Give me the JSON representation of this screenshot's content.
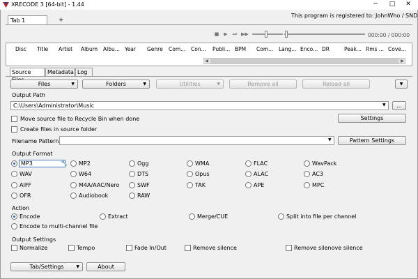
{
  "window": {
    "title": "XRECODE 3 [64-bit] - 1.44",
    "minimize": "─",
    "maximize": "□",
    "close": "✕"
  },
  "registration": "This program is registered to: JohnWho / SND",
  "tabs": {
    "tab1": "Tab 1",
    "plus": "+"
  },
  "player": {
    "time": "000:00 / 000:00",
    "stop": "■",
    "play": "▶",
    "skip": "⏭",
    "next": "▶▶"
  },
  "columns": [
    "Disc",
    "Title",
    "Artist",
    "Album",
    "Albu...",
    "Year",
    "Genre",
    "Com...",
    "Con...",
    "Publi...",
    "BPM",
    "Com...",
    "Lang...",
    "Enco...",
    "DR",
    "Peak...",
    "Rms ...",
    "Cove..."
  ],
  "scroll": {
    "left": "◀",
    "right": "▶"
  },
  "subtabs": {
    "source": "Source Files",
    "metadata": "Metadata",
    "log": "Log"
  },
  "toolbar": {
    "files": "Files",
    "folders": "Folders",
    "utilities": "Utilities",
    "remove_all": "Remove all",
    "reload_all": "Reload all",
    "arrow": "▼"
  },
  "output_path": {
    "label": "Output Path",
    "value": "C:\\Users\\Administrator\\Music",
    "browse": "..."
  },
  "options": {
    "move_recycle": "Move source file to Recycle Bin when done",
    "create_in_source": "Create files in source folder",
    "settings": "Settings"
  },
  "filename_pattern": {
    "label": "Filename Pattern:",
    "value": "",
    "button": "Pattern Settings"
  },
  "output_format": {
    "label": "Output Format",
    "formats": [
      [
        "MP3",
        "MP2",
        "Ogg",
        "WMA",
        "FLAC",
        "WavPack"
      ],
      [
        "WAV",
        "W64",
        "DTS",
        "Opus",
        "ALAC",
        "AC3"
      ],
      [
        "AIFF",
        "M4A/AAC/Nero",
        "SWF",
        "TAK",
        "APE",
        "MPC"
      ],
      [
        "OFR",
        "Audiobook",
        "RAW"
      ]
    ],
    "selected": "MP3"
  },
  "action": {
    "label": "Action",
    "encode": "Encode",
    "extract": "Extract",
    "merge": "Merge/CUE",
    "split": "Split into file per channel",
    "encode_multi": "Encode to multi-channel file",
    "selected": "Encode"
  },
  "output_settings": {
    "label": "Output Settings",
    "normalize": "Normalize",
    "tempo": "Tempo",
    "fade": "Fade In/Out",
    "remove_silence": "Remove silence",
    "remove_silenove": "Remove silenove silence"
  },
  "footer": {
    "tab_settings": "Tab/Settings",
    "about": "About"
  },
  "colors": {
    "accent": "#2a5fb0",
    "icon_red": "#cc1f1f"
  },
  "icons": {
    "app": "xrecode-icon",
    "wrench": "wrench-icon",
    "dropdown": "chevron-down-icon"
  }
}
